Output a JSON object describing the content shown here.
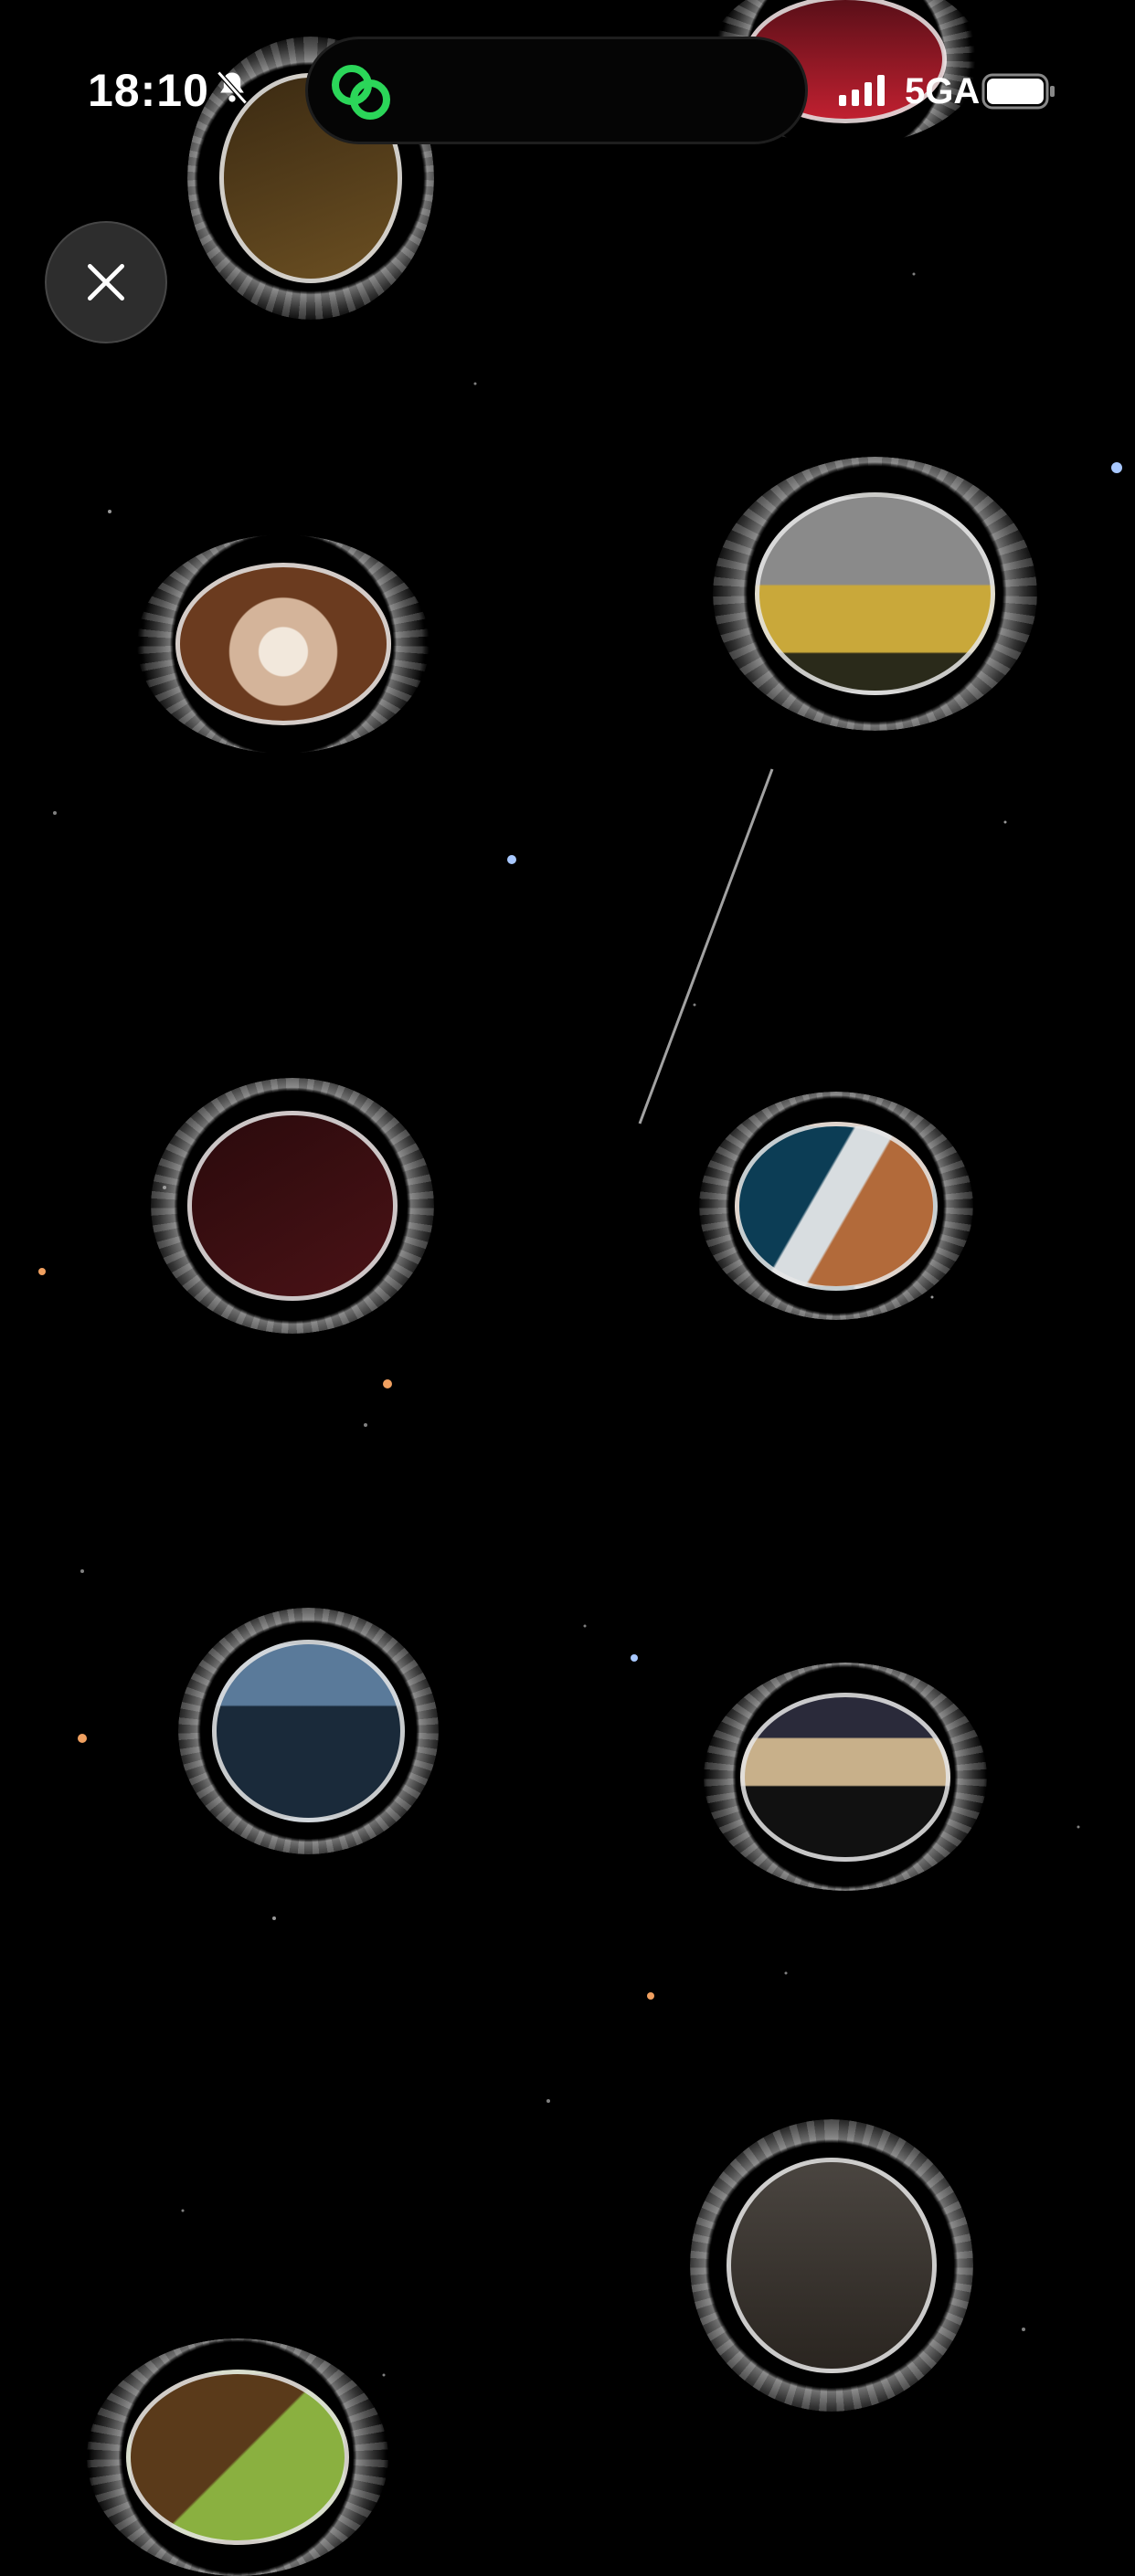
{
  "status_bar": {
    "time": "18:10",
    "network": "5GA",
    "icons": [
      "bell-slash-icon",
      "app-link-icon",
      "cellular-signal-icon",
      "battery-icon"
    ],
    "accent_color": "#2bd659"
  },
  "close_button": {
    "icon": "close-icon"
  },
  "bubbles": [
    {
      "name": "memory-bubble-brown-box",
      "colors": [
        "#3b2a12",
        "#6b4f22"
      ]
    },
    {
      "name": "memory-bubble-red-figure",
      "colors": [
        "#5a0f18",
        "#c02030"
      ]
    },
    {
      "name": "memory-bubble-dog",
      "colors": [
        "#d4b49a",
        "#6b3b1f"
      ]
    },
    {
      "name": "memory-bubble-yellow-machine",
      "colors": [
        "#8a8a8a",
        "#c9a83a"
      ]
    },
    {
      "name": "memory-bubble-burgundy-passport",
      "colors": [
        "#2a0a0c",
        "#4a1216"
      ]
    },
    {
      "name": "memory-bubble-supplement-bottle",
      "colors": [
        "#0c3d55",
        "#b26a3a"
      ]
    },
    {
      "name": "memory-bubble-aerial-view",
      "colors": [
        "#1a2a3a",
        "#5a7a9a"
      ]
    },
    {
      "name": "memory-bubble-window-view",
      "colors": [
        "#2a2a3a",
        "#c8b08a"
      ]
    },
    {
      "name": "memory-bubble-grey-texture",
      "colors": [
        "#4a4540",
        "#2a2520"
      ]
    },
    {
      "name": "memory-bubble-food",
      "colors": [
        "#5a3a1a",
        "#8ab040"
      ]
    }
  ]
}
